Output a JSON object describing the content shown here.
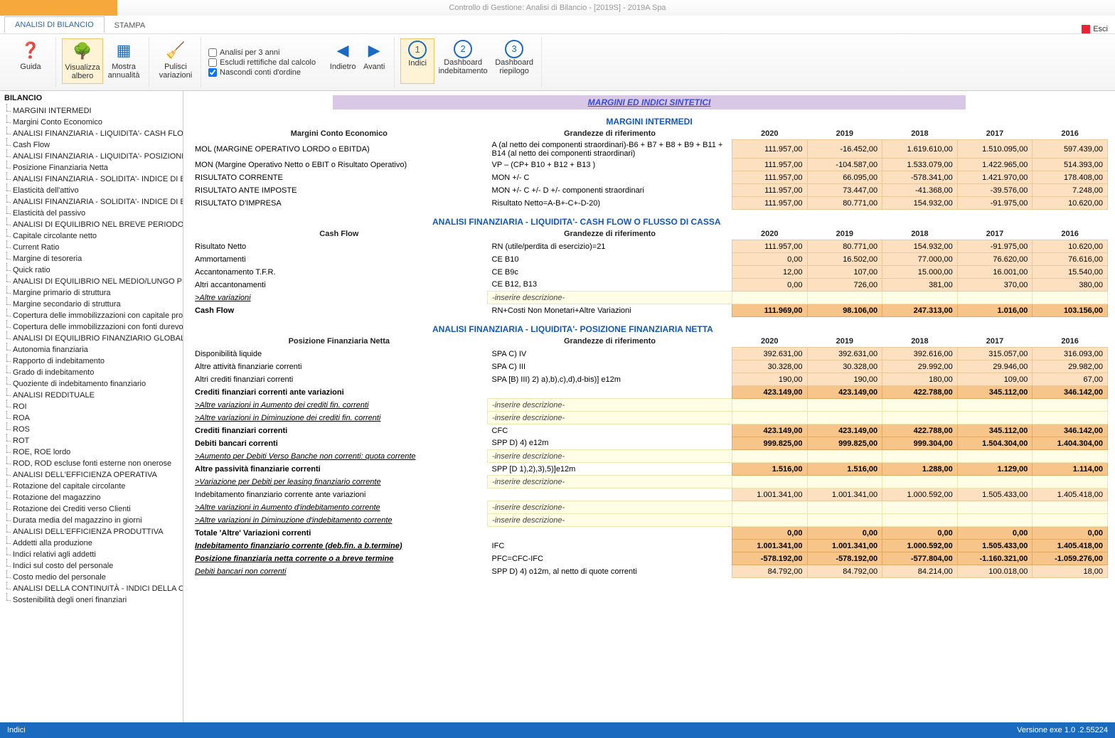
{
  "window_title": "Controllo di Gestione: Analisi di Bilancio - [2019S] - 2019A Spa",
  "exit_label": "Esci",
  "orange_tab": "",
  "tabs": [
    "ANALISI DI BILANCIO",
    "STAMPA"
  ],
  "ribbon": {
    "guida": "Guida",
    "visualizza": "Visualizza albero",
    "mostra": "Mostra annualità",
    "pulisci": "Pulisci variazioni",
    "chk1": "Analisi per 3 anni",
    "chk2": "Escludi rettifiche dal calcolo",
    "chk3": "Nascondi conti d'ordine",
    "indietro": "Indietro",
    "avanti": "Avanti",
    "step1": "Indici",
    "step2": "Dashboard indebitamento",
    "step3": "Dashboard riepilogo"
  },
  "tree_header": "BILANCIO",
  "tree": [
    "MARGINI INTERMEDI",
    "Margini Conto Economico",
    "ANALISI FINANZIARIA - LIQUIDITA'- CASH FLOW",
    "Cash Flow",
    "ANALISI FINANZIARIA - LIQUIDITA'- POSIZIONE F",
    "Posizione Finanziaria Netta",
    "ANALISI FINANZIARIA - SOLIDITA'- INDICE DI ELA",
    "Elasticità dell'attivo",
    "ANALISI FINANZIARIA - SOLIDITA'- INDICE DI ELA",
    "Elasticità del passivo",
    "ANALISI DI EQUILIBRIO NEL BREVE PERIODO (O D",
    "Capitale circolante netto",
    "Current Ratio",
    "Margine di tesoreria",
    "Quick ratio",
    "ANALISI DI EQUILIBRIO NEL MEDIO/LUNGO PERIO",
    "Margine primario di struttura",
    "Margine secondario di struttura",
    "Copertura delle immobilizzazioni con capitale pro",
    "Copertura delle immobilizzazioni con fonti durevo",
    "ANALISI DI EQUILIBRIO FINANZIARIO GLOBALE D",
    "Autonomia finanziaria",
    "Rapporto di indebitamento",
    "Grado di indebitamento",
    "Quoziente di indebitamento finanziario",
    "ANALISI REDDITUALE",
    "ROI",
    "ROA",
    "ROS",
    "ROT",
    "ROE, ROE lordo",
    "ROD, ROD escluse fonti esterne non onerose",
    "ANALISI DELL'EFFICIENZA OPERATIVA",
    "Rotazione del capitale circolante",
    "Rotazione del magazzino",
    "Rotazione dei Crediti verso Clienti",
    "Durata media del magazzino in giorni",
    "ANALISI DELL'EFFICIENZA PRODUTTIVA",
    "Addetti alla produzione",
    "Indici relativi agli addetti",
    "Indici sul costo del personale",
    "Costo medio del personale",
    "ANALISI DELLA CONTINUITÀ - INDICI DELLA CRIS",
    "Sostenibilità degli oneri finanziari"
  ],
  "main_header": "MARGINI ED INDICI SINTETICI",
  "years": [
    "2020",
    "2019",
    "2018",
    "2017",
    "2016"
  ],
  "sec1": {
    "title": "MARGINI INTERMEDI",
    "h1": "Margini Conto Economico",
    "h2": "Grandezze di riferimento",
    "rows": [
      {
        "l": "MOL (MARGINE OPERATIVO LORDO o EBITDA)",
        "r": "A (al netto dei componenti straordinari)-B6 + B7 + B8 + B9 + B11 + B14 (al netto dei componenti straordinari)",
        "v": [
          "111.957,00",
          "-16.452,00",
          "1.619.610,00",
          "1.510.095,00",
          "597.439,00"
        ]
      },
      {
        "l": "MON (Margine Operativo Netto o EBIT o Risultato Operativo)",
        "r": "VP – (CP+ B10 + B12 + B13 )",
        "v": [
          "111.957,00",
          "-104.587,00",
          "1.533.079,00",
          "1.422.965,00",
          "514.393,00"
        ]
      },
      {
        "l": "RISULTATO CORRENTE",
        "r": "MON +/- C",
        "v": [
          "111.957,00",
          "66.095,00",
          "-578.341,00",
          "1.421.970,00",
          "178.408,00"
        ]
      },
      {
        "l": "RISULTATO ANTE IMPOSTE",
        "r": "MON +/- C +/- D +/- componenti straordinari",
        "v": [
          "111.957,00",
          "73.447,00",
          "-41.368,00",
          "-39.576,00",
          "7.248,00"
        ]
      },
      {
        "l": "RISULTATO D'IMPRESA",
        "r": "Risultato Netto=A-B+-C+-D-20)",
        "v": [
          "111.957,00",
          "80.771,00",
          "154.932,00",
          "-91.975,00",
          "10.620,00"
        ]
      }
    ]
  },
  "sec2": {
    "title": "ANALISI FINANZIARIA - LIQUIDITA'- CASH FLOW O FLUSSO DI CASSA",
    "h1": "Cash Flow",
    "h2": "Grandezze di riferimento",
    "rows": [
      {
        "l": "Risultato Netto",
        "r": "RN (utile/perdita di esercizio)=21",
        "v": [
          "111.957,00",
          "80.771,00",
          "154.932,00",
          "-91.975,00",
          "10.620,00"
        ]
      },
      {
        "l": "Ammortamenti",
        "r": "CE B10",
        "v": [
          "0,00",
          "16.502,00",
          "77.000,00",
          "76.620,00",
          "76.616,00"
        ]
      },
      {
        "l": "Accantonamento T.F.R.",
        "r": "CE B9c",
        "v": [
          "12,00",
          "107,00",
          "15.000,00",
          "16.001,00",
          "15.540,00"
        ]
      },
      {
        "l": "Altri accantonamenti",
        "r": "CE B12, B13",
        "v": [
          "0,00",
          "726,00",
          "381,00",
          "370,00",
          "380,00"
        ]
      },
      {
        "l": ">Altre variazioni",
        "r": "-inserire descrizione-",
        "yellow": true
      },
      {
        "l": "Cash Flow",
        "r": "RN+Costi Non Monetari+Altre Variazioni",
        "b": true,
        "v": [
          "111.969,00",
          "98.106,00",
          "247.313,00",
          "1.016,00",
          "103.156,00"
        ]
      }
    ]
  },
  "sec3": {
    "title": "ANALISI FINANZIARIA - LIQUIDITA'- POSIZIONE FINANZIARIA NETTA",
    "h1": "Posizione Finanziaria Netta",
    "h2": "Grandezze di riferimento",
    "rows": [
      {
        "l": "Disponibilità liquide",
        "r": "SPA C) IV",
        "v": [
          "392.631,00",
          "392.631,00",
          "392.616,00",
          "315.057,00",
          "316.093,00"
        ]
      },
      {
        "l": "Altre attività finanziarie correnti",
        "r": "SPA C) III",
        "v": [
          "30.328,00",
          "30.328,00",
          "29.992,00",
          "29.946,00",
          "29.982,00"
        ]
      },
      {
        "l": "Altri crediti finanziari correnti",
        "r": "SPA [B) III) 2) a),b),c),d),d-bis)] e12m",
        "v": [
          "190,00",
          "190,00",
          "180,00",
          "109,00",
          "67,00"
        ]
      },
      {
        "l": "Crediti finanziari correnti ante variazioni",
        "b": true,
        "v": [
          "423.149,00",
          "423.149,00",
          "422.788,00",
          "345.112,00",
          "346.142,00"
        ]
      },
      {
        "l": ">Altre variazioni in Aumento dei crediti fin. correnti",
        "r": "-inserire descrizione-",
        "yellow": true,
        "ui": true
      },
      {
        "l": ">Altre variazioni in Diminuzione dei crediti fin. correnti",
        "r": "-inserire descrizione-",
        "yellow": true,
        "ui": true
      },
      {
        "l": "Crediti finanziari correnti",
        "r": "CFC",
        "b": true,
        "v": [
          "423.149,00",
          "423.149,00",
          "422.788,00",
          "345.112,00",
          "346.142,00"
        ]
      },
      {
        "l": "Debiti bancari correnti",
        "r": "SPP D) 4) e12m",
        "b": true,
        "v": [
          "999.825,00",
          "999.825,00",
          "999.304,00",
          "1.504.304,00",
          "1.404.304,00"
        ]
      },
      {
        "l": ">Aumento per Debiti Verso Banche non correnti: quota corrente",
        "r": "-inserire descrizione-",
        "yellow": true,
        "ui": true
      },
      {
        "l": "Altre passività finanziarie correnti",
        "r": "SPP [D 1),2),3),5)]e12m",
        "b": true,
        "v": [
          "1.516,00",
          "1.516,00",
          "1.288,00",
          "1.129,00",
          "1.114,00"
        ]
      },
      {
        "l": ">Variazione per Debiti per leasing finanziario corrente",
        "r": "-inserire descrizione-",
        "yellow": true,
        "ui": true
      },
      {
        "l": "Indebitamento finanziario corrente ante variazioni",
        "v": [
          "1.001.341,00",
          "1.001.341,00",
          "1.000.592,00",
          "1.505.433,00",
          "1.405.418,00"
        ]
      },
      {
        "l": ">Altre variazioni in Aumento d'indebitamento corrente",
        "r": "-inserire descrizione-",
        "yellow": true,
        "ui": true
      },
      {
        "l": ">Altre variazioni in Diminuzione d'indebitamento corrente",
        "r": "-inserire descrizione-",
        "yellow": true,
        "ui": true
      },
      {
        "l": "Totale 'Altre' Variazioni correnti",
        "b": true,
        "v": [
          "0,00",
          "0,00",
          "0,00",
          "0,00",
          "0,00"
        ]
      },
      {
        "l": "Indebitamento finanziario corrente (deb.fin. a b.termine)",
        "r": "IFC",
        "b": true,
        "ui": true,
        "v": [
          "1.001.341,00",
          "1.001.341,00",
          "1.000.592,00",
          "1.505.433,00",
          "1.405.418,00"
        ]
      },
      {
        "l": "Posizione finanziaria netta corrente o a breve termine",
        "r": "PFC=CFC-IFC",
        "b": true,
        "ui": true,
        "v": [
          "-578.192,00",
          "-578.192,00",
          "-577.804,00",
          "-1.160.321,00",
          "-1.059.276,00"
        ]
      },
      {
        "l": "Debiti bancari non correnti",
        "r": "SPP D) 4) o12m, al netto di quote correnti",
        "ui": true,
        "v": [
          "84.792,00",
          "84.792,00",
          "84.214,00",
          "100.018,00",
          "18,00"
        ]
      }
    ]
  },
  "status_left": "Indici",
  "status_right": "Versione exe 1.0 .2.55224"
}
